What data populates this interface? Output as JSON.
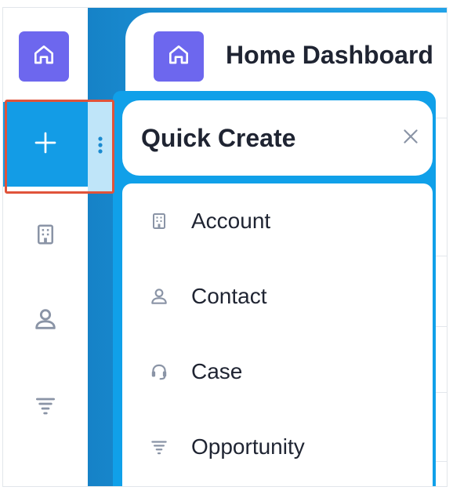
{
  "nav": {
    "items": [
      {
        "name": "home",
        "icon": "home-icon"
      },
      {
        "name": "quick-create",
        "icon": "plus-icon",
        "active": true
      },
      {
        "name": "accounts",
        "icon": "building-icon"
      },
      {
        "name": "contacts",
        "icon": "person-icon"
      },
      {
        "name": "opportunities",
        "icon": "funnel-icon"
      }
    ],
    "more_icon": "vertical-dots-icon"
  },
  "header": {
    "title": "Home Dashboard",
    "icon": "home-icon"
  },
  "quick_create": {
    "title": "Quick Create",
    "close_icon": "close-icon",
    "items": [
      {
        "label": "Account",
        "icon": "building-icon"
      },
      {
        "label": "Contact",
        "icon": "person-icon"
      },
      {
        "label": "Case",
        "icon": "headset-icon"
      },
      {
        "label": "Opportunity",
        "icon": "funnel-icon"
      }
    ]
  },
  "colors": {
    "accent": "#139ce6",
    "tile": "#6d67ee",
    "highlight": "#e0533a"
  }
}
